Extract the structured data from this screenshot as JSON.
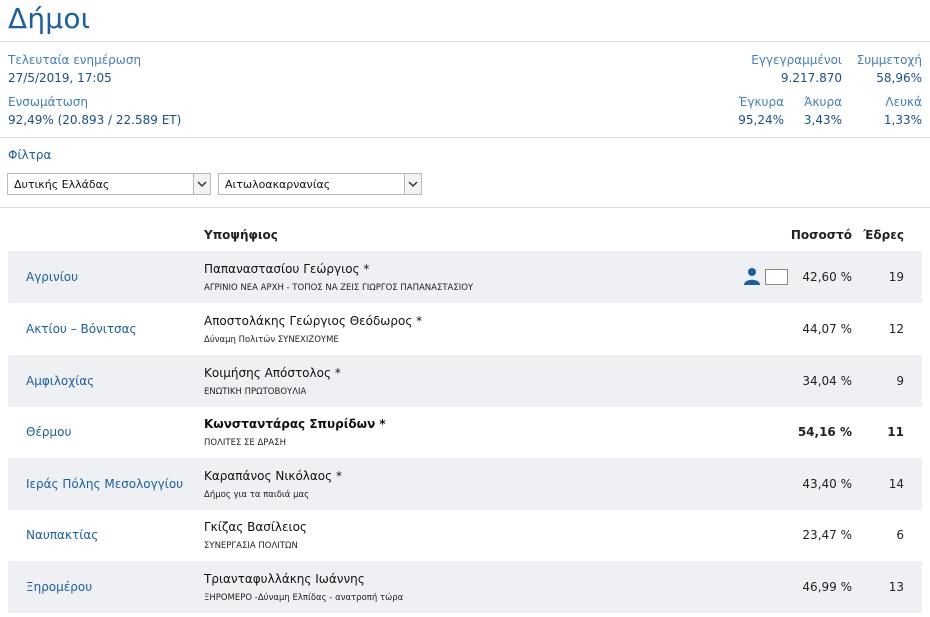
{
  "page": {
    "title": "Δήμοι"
  },
  "stats": {
    "last_update_label": "Τελευταία ενημέρωση",
    "last_update_value": "27/5/2019, 17:05",
    "integration_label": "Ενσωμάτωση",
    "integration_value": "92,49% (20.893 / 22.589 ΕΤ)",
    "registered_label": "Εγγεγραμμένοι",
    "registered_value": "9.217.870",
    "turnout_label": "Συμμετοχή",
    "turnout_value": "58,96%",
    "valid_label": "Έγκυρα",
    "valid_value": "95,24%",
    "invalid_label": "Άκυρα",
    "invalid_value": "3,43%",
    "blank_label": "Λευκά",
    "blank_value": "1,33%"
  },
  "filters": {
    "title": "Φίλτρα",
    "region_selected": "Δυτικής Ελλάδας",
    "unit_selected": "Αιτωλοακαρνανίας"
  },
  "table": {
    "headers": {
      "candidate": "Υποψήφιος",
      "percent": "Ποσοστό",
      "seats": "Έδρες"
    },
    "rows": [
      {
        "municipality": "Αγρινίου",
        "candidate": "Παπαναστασίου Γεώργιος *",
        "party": "ΑΓΡΙΝΙΟ ΝΕΑ ΑΡΧΗ - ΤΟΠΟΣ ΝΑ ΖΕΙΣ ΓΙΩΡΓΟΣ ΠΑΠΑΝΑΣΤΑΣΙΟΥ",
        "percent": "42,60 %",
        "seats": "19"
      },
      {
        "municipality": "Ακτίου – Βόνιτσας",
        "candidate": "Αποστολάκης Γεώργιος Θεόδωρος *",
        "party": "Δύναμη Πολιτών ΣΥΝΕΧΙΖΟΥΜΕ",
        "percent": "44,07 %",
        "seats": "12"
      },
      {
        "municipality": "Αμφιλοχίας",
        "candidate": "Κοιμήσης Απόστολος *",
        "party": "ΕΝΩΤΙΚΗ ΠΡΩΤΟΒΟΥΛΙΑ",
        "percent": "34,04 %",
        "seats": "9"
      },
      {
        "municipality": "Θέρμου",
        "candidate": "Κωνσταντάρας Σπυρίδων *",
        "party": "ΠΟΛΙΤΕΣ ΣΕ ΔΡΑΣΗ",
        "percent": "54,16 %",
        "seats": "11"
      },
      {
        "municipality": "Ιεράς Πόλης Μεσολογγίου",
        "candidate": "Καραπάνος Νικόλαος *",
        "party": "Δήμος για τα παιδιά μας",
        "percent": "43,40 %",
        "seats": "14"
      },
      {
        "municipality": "Ναυπακτίας",
        "candidate": "Γκίζας Βασίλειος",
        "party": "ΣΥΝΕΡΓΑΣΙΑ ΠΟΛΙΤΩΝ",
        "percent": "23,47 %",
        "seats": "6"
      },
      {
        "municipality": "Ξηρομέρου",
        "candidate": "Τριανταφυλλάκης Ιωάννης",
        "party": "ΞΗΡΟΜΕΡΟ -Δύναμη Ελπίδας - ανατροπή τώρα",
        "percent": "46,99 %",
        "seats": "13"
      }
    ]
  },
  "icons": {
    "row1_person": "person-icon",
    "row1_photo": "photo-placeholder"
  },
  "colors": {
    "accent": "#1a5fa6",
    "row_alt": "#eef0f3"
  }
}
